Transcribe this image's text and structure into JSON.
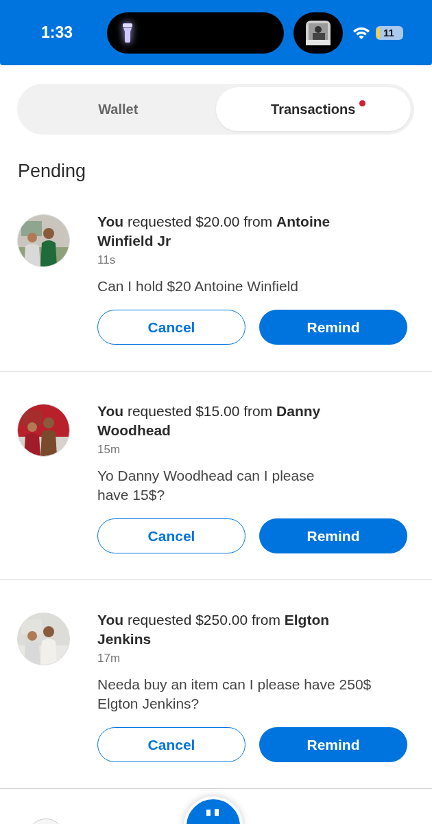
{
  "status_bar": {
    "time": "1:33",
    "battery": "11"
  },
  "tabs": [
    {
      "label": "Wallet",
      "selected": false,
      "badge": false
    },
    {
      "label": "Transactions",
      "selected": true,
      "badge": true
    }
  ],
  "section_title": "Pending",
  "requests": [
    {
      "avatar": {
        "kind": "picture"
      },
      "text": "**You** requested $20.00 from **Antoine Winfield Jr**",
      "time": "11s",
      "note": "Can I hold $20 Antoine Winfield",
      "actions": [
        "Cancel",
        "Remind"
      ]
    },
    {
      "avatar": {
        "kind": "picture"
      },
      "text": "**You** requested $15.00 from **Danny Woodhead**",
      "time": "15m",
      "note": "Yo Danny Woodhead can I please\nhave 15$?",
      "actions": [
        "Cancel",
        "Remind"
      ]
    },
    {
      "avatar": {
        "kind": "picture"
      },
      "text": "**You** requested $250.00 from **Elgton Jenkins**",
      "time": "17m",
      "note": "Needa buy an item can I please have 250$\nElgton Jenkins?",
      "actions": [
        "Cancel",
        "Remind"
      ]
    }
  ]
}
